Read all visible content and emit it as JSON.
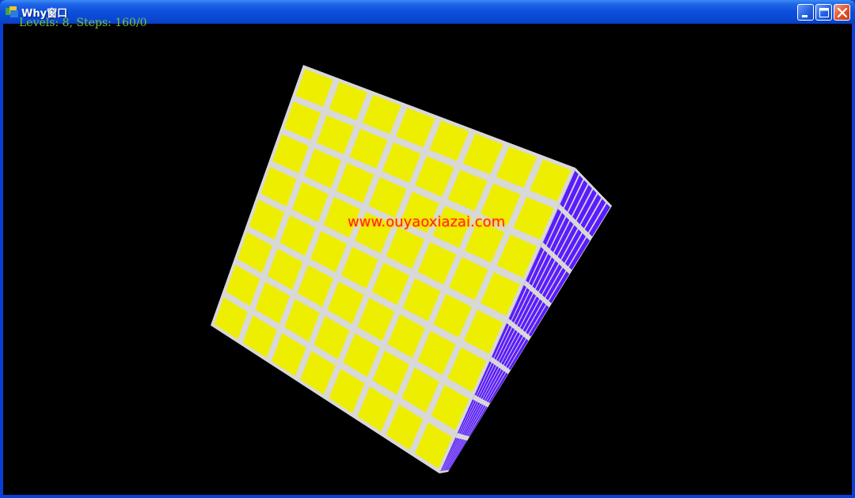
{
  "window": {
    "title": "Why窗口",
    "buttons": [
      "minimize",
      "maximize",
      "close"
    ],
    "frame_color": "#0a3fd6"
  },
  "game": {
    "status": "Levels: 8, Steps: 160/0",
    "watermark": "www.ouyaoxiazai.com",
    "cube": {
      "levels": 8,
      "front_face_color": "#eeee00",
      "side_face_color": "#5a1cff",
      "edge_color": "#d8d8d8"
    }
  },
  "colors": {
    "background": "#000000",
    "status_text": "#7fbf3c"
  }
}
